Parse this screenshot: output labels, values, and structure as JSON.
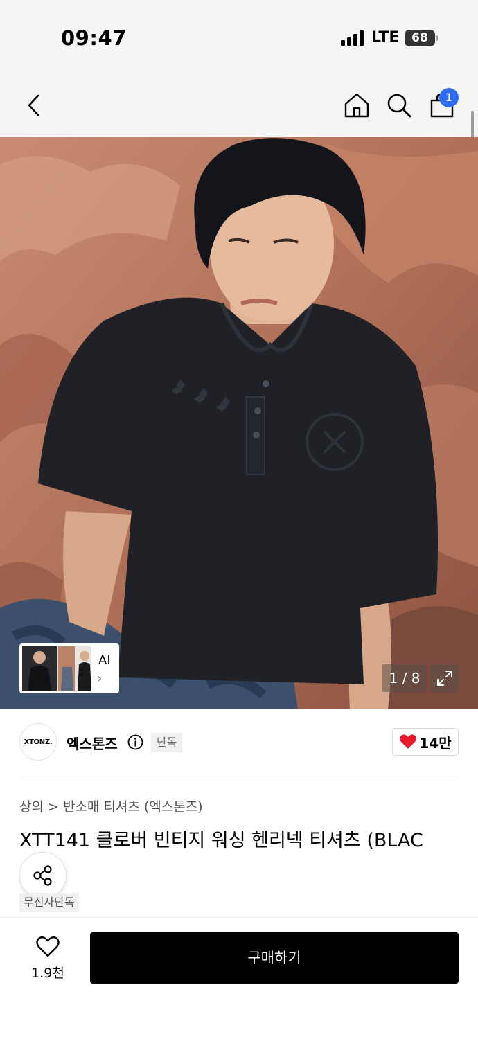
{
  "status_bar": {
    "time": "09:47",
    "network": "LTE",
    "battery": "68"
  },
  "nav": {
    "cart_count": "1",
    "icons": [
      "back-icon",
      "home-icon",
      "search-icon",
      "shopping-bag-icon"
    ]
  },
  "gallery": {
    "counter": "1 / 8",
    "ai_label": "AI",
    "ai_chevron": "›"
  },
  "brand": {
    "logo_text": "XTONZ.",
    "name": "엑스톤즈",
    "badge": "단독",
    "like_count": "14만"
  },
  "product": {
    "breadcrumb": "상의 > 반소매 티셔츠 (엑스톤즈)",
    "title": "XTT141 클로버 빈티지 워싱 헨리넥 티셔츠 (BLAC",
    "badge": "무신사단독"
  },
  "bottom_bar": {
    "wish_count": "1.9천",
    "buy_label": "구매하기"
  },
  "colors": {
    "accent_blue": "#2f6cf6",
    "heart_red": "#e8192c",
    "buy_button": "#000000"
  }
}
